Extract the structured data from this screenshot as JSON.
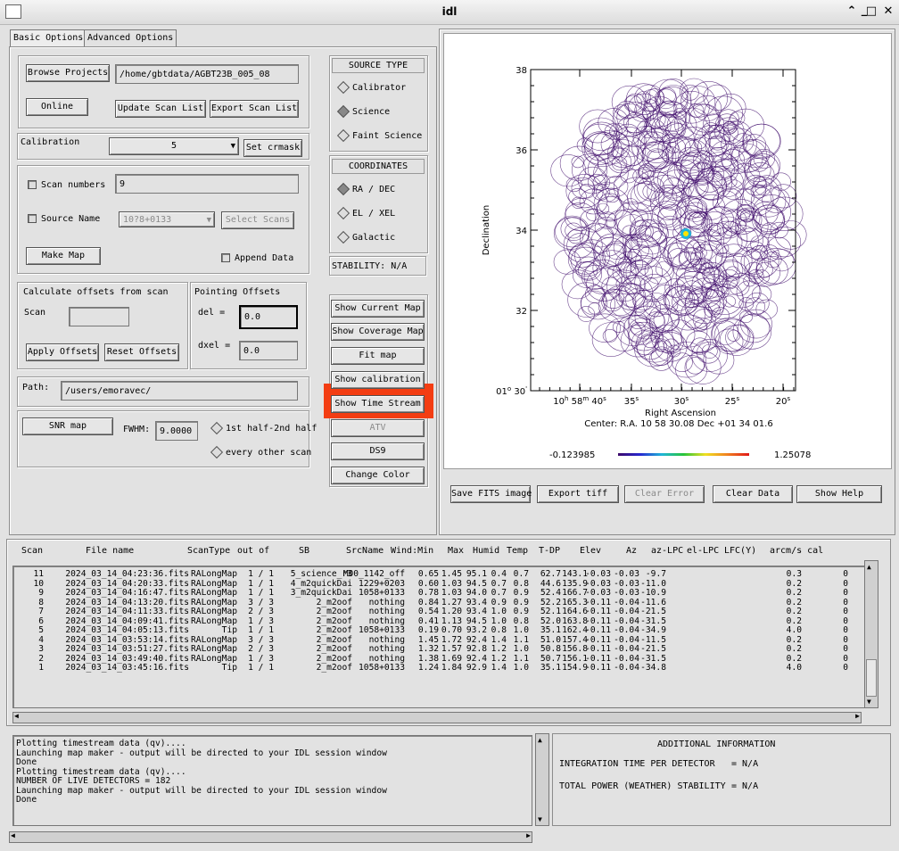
{
  "window": {
    "title": "idl"
  },
  "tabs": [
    {
      "label": "Basic Options",
      "active": true
    },
    {
      "label": "Advanced Options",
      "active": false
    }
  ],
  "basic": {
    "browse_label": "Browse Projects",
    "project_path": "/home/gbtdata/AGBT23B_005_08",
    "online_label": "Online",
    "update_label": "Update Scan List",
    "export_label": "Export Scan List",
    "calibration_label": "Calibration",
    "calibration_value": "5",
    "set_crmask_label": "Set crmask",
    "scan_numbers_label": "Scan numbers",
    "scan_numbers_value": "9",
    "source_name_label": "Source Name",
    "source_name_value": "10?8+0133",
    "select_scans_label": "Select Scans",
    "make_map_label": "Make Map",
    "append_label": "Append Data",
    "calc_offsets_title": "Calculate offsets from scan",
    "scan_label": "Scan",
    "scan_value": "",
    "apply_offsets_label": "Apply Offsets",
    "reset_offsets_label": "Reset Offsets",
    "pointing_title": "Pointing Offsets",
    "del_label": "del  =",
    "del_value": "0.0",
    "dxel_label": "dxel =",
    "dxel_value": "0.0",
    "path_label": "Path:",
    "path_value": "/users/emoravec/",
    "snr_label": "SNR map",
    "fwhm_label": "FWHM:",
    "fwhm_value": "9.0000",
    "half_label": "1st half-2nd half",
    "every_other_label": "every other scan"
  },
  "source_type": {
    "title": "SOURCE TYPE",
    "options": [
      "Calibrator",
      "Science",
      "Faint Science"
    ],
    "selected": 1
  },
  "coordinates": {
    "title": "COORDINATES",
    "options": [
      "RA / DEC",
      "EL / XEL",
      "Galactic"
    ],
    "selected": 0
  },
  "stability": "STABILITY: N/A",
  "actions": [
    "Show Current Map",
    "Show Coverage Map",
    "Fit map",
    "Show calibration",
    "Show Time Stream",
    "ATV",
    "DS9",
    "Change Color"
  ],
  "plot": {
    "ylabel": "Declination",
    "xlabel": "Right Ascension",
    "yticks": [
      "38",
      "36",
      "34",
      "32"
    ],
    "ytick_bottom_deg": "01",
    "ytick_bottom_min": "30",
    "xticks": [
      {
        "h": "10",
        "hu": "h",
        "m": "58",
        "mu": "m",
        "s": "40",
        "su": "s"
      },
      {
        "s": "35",
        "su": "s"
      },
      {
        "s": "30",
        "su": "s"
      },
      {
        "s": "25",
        "su": "s"
      },
      {
        "s": "20",
        "su": "s"
      }
    ],
    "center_text": "Center:  R.A. 10 58 30.08    Dec  +01 34 01.6",
    "cbar_min": "-0.123985",
    "cbar_max": "1.25078"
  },
  "plot_buttons": [
    "Save FITS image",
    "Export tiff",
    "Clear Error",
    "Clear Data",
    "Show Help"
  ],
  "table": {
    "columns": [
      "Scan",
      "File name",
      "ScanType",
      "out of",
      "SB",
      "SrcName",
      "Wind:Min",
      "Max",
      "Humid",
      "Temp",
      "T-DP",
      "Elev",
      "Az",
      "az-LPC",
      "el-LPC",
      "LFC(Y)",
      "arcm/s cal"
    ],
    "rows": [
      [
        "11",
        "2024_03_14_04:23:36.fits",
        "RALongMap",
        "1 / 1",
        "5_science_r3",
        "M00_1142_off",
        "0.65",
        "1.45",
        "95.1",
        "0.4",
        "0.7",
        "62.7",
        "143.1",
        "-0.03",
        "-0.03",
        "-9.7",
        "0.3",
        "0"
      ],
      [
        "10",
        "2024_03_14_04:20:33.fits",
        "RALongMap",
        "1 / 1",
        "4_m2quickDai",
        "1229+0203",
        "0.60",
        "1.03",
        "94.5",
        "0.7",
        "0.8",
        "44.6",
        "135.9",
        "-0.03",
        "-0.03",
        "-11.0",
        "0.2",
        "0"
      ],
      [
        "9",
        "2024_03_14_04:16:47.fits",
        "RALongMap",
        "1 / 1",
        "3_m2quickDai",
        "1058+0133",
        "0.78",
        "1.03",
        "94.0",
        "0.7",
        "0.9",
        "52.4",
        "166.7",
        "-0.03",
        "-0.03",
        "-10.9",
        "0.2",
        "0"
      ],
      [
        "8",
        "2024_03_14_04:13:20.fits",
        "RALongMap",
        "3 / 3",
        "2_m2oof",
        "nothing",
        "0.84",
        "1.27",
        "93.4",
        "0.9",
        "0.9",
        "52.2",
        "165.3",
        "-0.11",
        "-0.04",
        "-11.6",
        "0.2",
        "0"
      ],
      [
        "7",
        "2024_03_14_04:11:33.fits",
        "RALongMap",
        "2 / 3",
        "2_m2oof",
        "nothing",
        "0.54",
        "1.20",
        "93.4",
        "1.0",
        "0.9",
        "52.1",
        "164.6",
        "-0.11",
        "-0.04",
        "-21.5",
        "0.2",
        "0"
      ],
      [
        "6",
        "2024_03_14_04:09:41.fits",
        "RALongMap",
        "1 / 3",
        "2_m2oof",
        "nothing",
        "0.41",
        "1.13",
        "94.5",
        "1.0",
        "0.8",
        "52.0",
        "163.8",
        "-0.11",
        "-0.04",
        "-31.5",
        "0.2",
        "0"
      ],
      [
        "5",
        "2024_03_14_04:05:13.fits",
        "Tip",
        "1 / 1",
        "2_m2oof",
        "1058+0133",
        "0.19",
        "0.70",
        "93.2",
        "0.8",
        "1.0",
        "35.1",
        "162.4",
        "-0.11",
        "-0.04",
        "-34.9",
        "4.0",
        "0"
      ],
      [
        "4",
        "2024_03_14_03:53:14.fits",
        "RALongMap",
        "3 / 3",
        "2_m2oof",
        "nothing",
        "1.45",
        "1.72",
        "92.4",
        "1.4",
        "1.1",
        "51.0",
        "157.4",
        "-0.11",
        "-0.04",
        "-11.5",
        "0.2",
        "0"
      ],
      [
        "3",
        "2024_03_14_03:51:27.fits",
        "RALongMap",
        "2 / 3",
        "2_m2oof",
        "nothing",
        "1.32",
        "1.57",
        "92.8",
        "1.2",
        "1.0",
        "50.8",
        "156.8",
        "-0.11",
        "-0.04",
        "-21.5",
        "0.2",
        "0"
      ],
      [
        "2",
        "2024_03_14_03:49:40.fits",
        "RALongMap",
        "1 / 3",
        "2_m2oof",
        "nothing",
        "1.38",
        "1.69",
        "92.4",
        "1.2",
        "1.1",
        "50.7",
        "156.1",
        "-0.11",
        "-0.04",
        "-31.5",
        "0.2",
        "0"
      ],
      [
        "1",
        "2024_03_14_03:45:16.fits",
        "Tip",
        "1 / 1",
        "2_m2oof",
        "1058+0133",
        "1.24",
        "1.84",
        "92.9",
        "1.4",
        "1.0",
        "35.1",
        "154.9",
        "-0.11",
        "-0.04",
        "-34.8",
        "4.0",
        "0"
      ]
    ]
  },
  "log_text": "Plotting timestream data (qv)....\nLaunching map maker - output will be directed to your IDL session window\nDone\nPlotting timestream data (qv)....\nNUMBER OF LIVE DETECTORS = 182\nLaunching map maker - output will be directed to your IDL session window\nDone",
  "info": {
    "title": "ADDITIONAL INFORMATION",
    "integration_label": "INTEGRATION TIME PER DETECTOR",
    "integration_value": "=  N/A",
    "power_label": "TOTAL POWER (WEATHER) STABILITY",
    "power_value": "=  N/A"
  },
  "colors": {
    "highlight": "#f33d12",
    "map": "#3d0a6a"
  }
}
